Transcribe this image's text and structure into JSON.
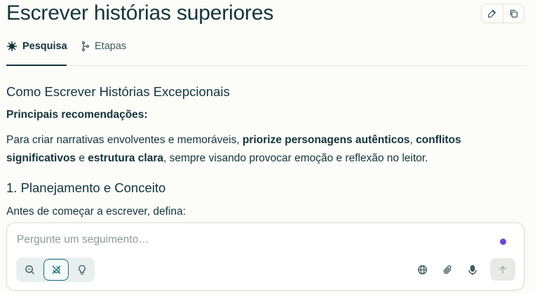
{
  "page": {
    "title": "Escrever histórias superiores"
  },
  "title_actions": [
    {
      "icon": "edit-icon"
    },
    {
      "icon": "copy-icon"
    }
  ],
  "tabs": [
    {
      "label": "Pesquisa",
      "icon": "research-icon",
      "active": true
    },
    {
      "label": "Etapas",
      "icon": "steps-icon",
      "active": false
    }
  ],
  "content": {
    "heading": "Como Escrever Histórias Excepcionais",
    "subheading": "Principais recomendações:",
    "paragraph": {
      "t1": "Para criar narrativas envolventes e memoráveis, ",
      "b1": "priorize personagens autênticos",
      "t2": ", ",
      "b2": "conflitos significativos",
      "t3": " e ",
      "b3": "estrutura clara",
      "t4": ", sempre visando provocar emoção e reflexão no leitor."
    },
    "section1_heading": "1. Planejamento e Conceito",
    "section1_text": "Antes de começar a escrever, defina:"
  },
  "composer": {
    "placeholder": "Pergunte um seguimento…",
    "value": "",
    "modes": [
      {
        "icon": "search-icon",
        "selected": false
      },
      {
        "icon": "research-icon",
        "selected": true
      },
      {
        "icon": "lightbulb-icon",
        "selected": false
      }
    ],
    "tools": [
      {
        "icon": "globe-icon"
      },
      {
        "icon": "paperclip-icon"
      },
      {
        "icon": "microphone-icon"
      }
    ],
    "send_icon": "arrow-up-icon",
    "accent_dot_color": "#6b46d9"
  },
  "colors": {
    "text": "#13343b",
    "accent": "#1a6a76",
    "background": "#fcfcf9"
  }
}
